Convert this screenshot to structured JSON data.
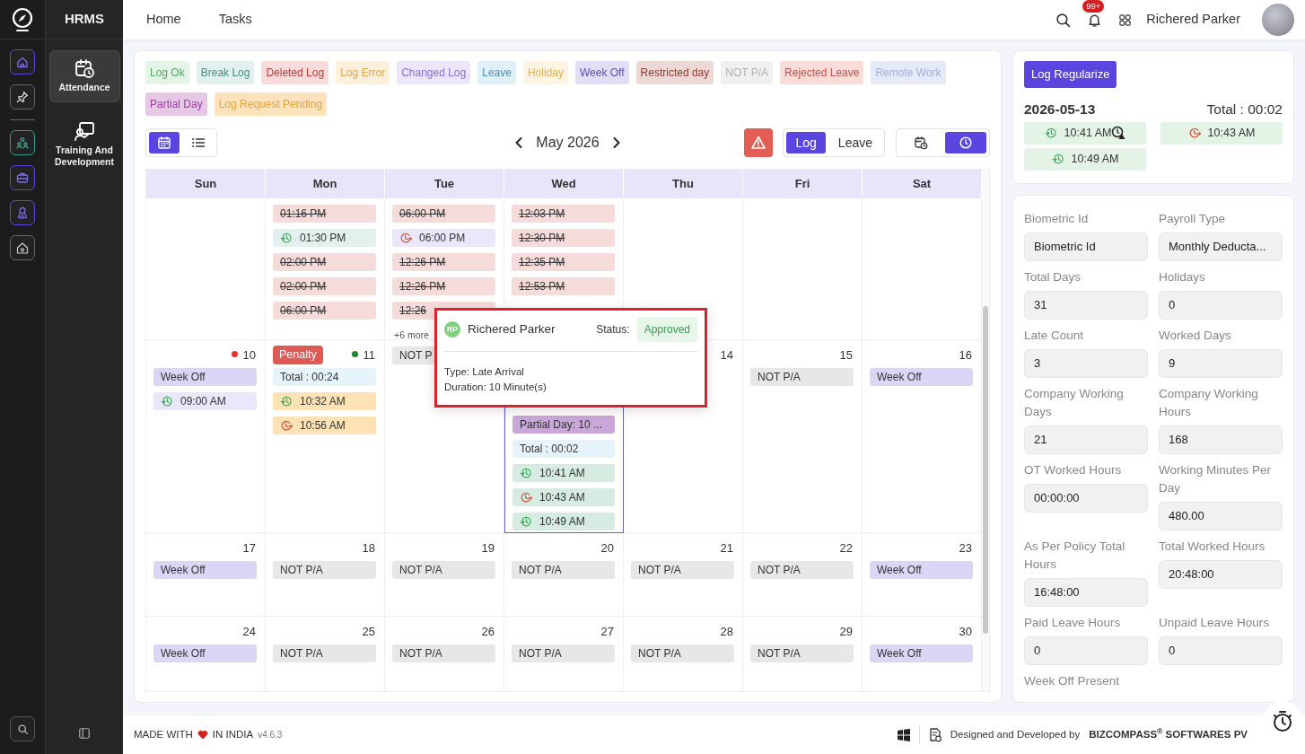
{
  "app": {
    "title": "HRMS"
  },
  "sidebar": {
    "items": [
      {
        "label": "Attendance",
        "kind": "attendance",
        "selected": true
      },
      {
        "label": "Training And Development",
        "kind": "training",
        "selected": false
      }
    ]
  },
  "header": {
    "nav": [
      "Home",
      "Tasks"
    ],
    "notifications": "99+",
    "user": "Richered Parker"
  },
  "legend": [
    {
      "label": "Log Ok",
      "kind": "log_ok"
    },
    {
      "label": "Break Log",
      "kind": "break_log"
    },
    {
      "label": "Deleted Log",
      "kind": "deleted"
    },
    {
      "label": "Log Error",
      "kind": "error"
    },
    {
      "label": "Changed Log",
      "kind": "changed"
    },
    {
      "label": "Leave",
      "kind": "leave"
    },
    {
      "label": "Holiday",
      "kind": "holiday"
    },
    {
      "label": "Week Off",
      "kind": "weekoff"
    },
    {
      "label": "Restricted day",
      "kind": "restricted"
    },
    {
      "label": "NOT P/A",
      "kind": "notpa"
    },
    {
      "label": "Rejected Leave",
      "kind": "rejected"
    },
    {
      "label": "Remote Work",
      "kind": "remote"
    },
    {
      "label": "Partial Day",
      "kind": "partial"
    },
    {
      "label": "Log Request Pending",
      "kind": "pending"
    }
  ],
  "toolbar": {
    "views": [
      {
        "kind": "calendar",
        "selected": true
      },
      {
        "kind": "list",
        "selected": false
      }
    ],
    "month": "May 2026",
    "modes": [
      {
        "label": "Log",
        "selected": true
      },
      {
        "label": "Leave",
        "selected": false
      }
    ],
    "tools": [
      {
        "kind": "calendar_clock",
        "selected": false
      },
      {
        "kind": "clock",
        "selected": true
      }
    ]
  },
  "calendar": {
    "weekdays": [
      "Sun",
      "Mon",
      "Tue",
      "Wed",
      "Thu",
      "Fri",
      "Sat"
    ],
    "weeks": [
      [
        {
          "selected": false
        },
        {
          "selected": false,
          "entries": [
            {
              "kind": "deleted",
              "text": "01:16 PM"
            },
            {
              "kind": "break_log",
              "clock_in": true,
              "text": "01:30 PM"
            },
            {
              "kind": "deleted",
              "text": "02:00 PM"
            },
            {
              "kind": "deleted",
              "text": "02:00 PM"
            },
            {
              "kind": "deleted",
              "text": "06:00 PM"
            }
          ]
        },
        {
          "selected": false,
          "more": "+6 more",
          "entries": [
            {
              "kind": "deleted",
              "text": "06:00 PM"
            },
            {
              "kind": "changed",
              "clock_out": true,
              "text": "06:00 PM"
            },
            {
              "kind": "deleted",
              "text": "12:26 PM"
            },
            {
              "kind": "deleted",
              "text": "12:26 PM"
            },
            {
              "kind": "deleted",
              "text": "12:26"
            }
          ]
        },
        {
          "selected": false,
          "entries": [
            {
              "kind": "deleted",
              "text": "12:03 PM"
            },
            {
              "kind": "deleted",
              "text": "12:30 PM"
            },
            {
              "kind": "deleted",
              "text": "12:35 PM"
            },
            {
              "kind": "deleted",
              "text": "12:53 PM"
            }
          ]
        },
        {
          "selected": false
        },
        {
          "selected": false
        },
        {
          "selected": false
        }
      ],
      [
        {
          "selected": false,
          "date": "10",
          "color": "#e0352b",
          "entries": [
            {
              "kind": "weekoff",
              "text": "Week Off"
            },
            {
              "kind": "changed",
              "clock_in": true,
              "text": "09:00 AM"
            }
          ]
        },
        {
          "selected": false,
          "date": "11",
          "color": "#1f8a2c",
          "badge": "Penalty",
          "entries": [
            {
              "kind": "leave",
              "text": "Total : 00:24"
            },
            {
              "kind": "pending",
              "clock_in": true,
              "text": "10:32 AM"
            },
            {
              "kind": "pending",
              "clock_out": true,
              "text": "10:56 AM"
            }
          ]
        },
        {
          "selected": false,
          "entries": [
            {
              "kind": "notpa",
              "text": "NOT P"
            }
          ]
        },
        {
          "selected": true,
          "entries": [
            {
              "kind": "partial",
              "text": "Partial Day: 10 ..."
            },
            {
              "kind": "leave",
              "text": "Total : 00:02"
            },
            {
              "kind": "log_ok",
              "clock_in": true,
              "text": "10:41 AM"
            },
            {
              "kind": "log_ok",
              "clock_out": true,
              "text": "10:43 AM"
            },
            {
              "kind": "log_ok",
              "clock_in": true,
              "text": "10:49 AM"
            }
          ]
        },
        {
          "selected": false,
          "date": "14"
        },
        {
          "selected": false,
          "date": "15",
          "entries": [
            {
              "kind": "notpa",
              "text": "NOT P/A"
            }
          ]
        },
        {
          "selected": false,
          "date": "16",
          "entries": [
            {
              "kind": "weekoff",
              "text": "Week Off"
            }
          ]
        }
      ],
      [
        {
          "selected": false,
          "date": "17",
          "entries": [
            {
              "kind": "weekoff",
              "text": "Week Off"
            }
          ]
        },
        {
          "selected": false,
          "date": "18",
          "entries": [
            {
              "kind": "notpa",
              "text": "NOT P/A"
            }
          ]
        },
        {
          "selected": false,
          "date": "19",
          "entries": [
            {
              "kind": "notpa",
              "text": "NOT P/A"
            }
          ]
        },
        {
          "selected": false,
          "date": "20",
          "entries": [
            {
              "kind": "notpa",
              "text": "NOT P/A"
            }
          ]
        },
        {
          "selected": false,
          "date": "21",
          "entries": [
            {
              "kind": "notpa",
              "text": "NOT P/A"
            }
          ]
        },
        {
          "selected": false,
          "date": "22",
          "entries": [
            {
              "kind": "notpa",
              "text": "NOT P/A"
            }
          ]
        },
        {
          "selected": false,
          "date": "23",
          "entries": [
            {
              "kind": "weekoff",
              "text": "Week Off"
            }
          ]
        }
      ],
      [
        {
          "selected": false,
          "date": "24",
          "entries": [
            {
              "kind": "weekoff",
              "text": "Week Off"
            }
          ]
        },
        {
          "selected": false,
          "date": "25",
          "entries": [
            {
              "kind": "notpa",
              "text": "NOT P/A"
            }
          ]
        },
        {
          "selected": false,
          "date": "26",
          "entries": [
            {
              "kind": "notpa",
              "text": "NOT P/A"
            }
          ]
        },
        {
          "selected": false,
          "date": "27",
          "entries": [
            {
              "kind": "notpa",
              "text": "NOT P/A"
            }
          ]
        },
        {
          "selected": false,
          "date": "28",
          "entries": [
            {
              "kind": "notpa",
              "text": "NOT P/A"
            }
          ]
        },
        {
          "selected": false,
          "date": "29",
          "entries": [
            {
              "kind": "notpa",
              "text": "NOT P/A"
            }
          ]
        },
        {
          "selected": false,
          "date": "30",
          "entries": [
            {
              "kind": "weekoff",
              "text": "Week Off"
            }
          ]
        }
      ]
    ]
  },
  "popover": {
    "initials": "RP",
    "name": "Richered Parker",
    "status_label": "Status:",
    "status": "Approved",
    "lines": [
      "Type: Late Arrival",
      "Duration: 10 Minute(s)"
    ]
  },
  "day_summary": {
    "button": "Log Regularize",
    "date": "2026-05-13",
    "total": "Total : 00:02",
    "entries": [
      {
        "kind": "in",
        "text": "10:41 AM",
        "warning": true
      },
      {
        "kind": "out",
        "text": "10:43 AM",
        "warning": false
      },
      {
        "kind": "in",
        "text": "10:49 AM",
        "warning": false
      }
    ]
  },
  "stats": [
    {
      "label": "Biometric Id",
      "value": "Biometric Id"
    },
    {
      "label": "Payroll Type",
      "value": "Monthly Deducta..."
    },
    {
      "label": "Total Days",
      "value": "31"
    },
    {
      "label": "Holidays",
      "value": "0"
    },
    {
      "label": "Late Count",
      "value": "3"
    },
    {
      "label": "Worked Days",
      "value": "9"
    },
    {
      "label": "Company Working Days",
      "value": "21"
    },
    {
      "label": "Company Working Hours",
      "value": "168"
    },
    {
      "label": "OT Worked Hours",
      "value": "00:00:00"
    },
    {
      "label": "Working Minutes Per Day",
      "value": "480.00"
    },
    {
      "label": "As Per Policy Total Hours",
      "value": "16:48:00"
    },
    {
      "label": "Total Worked Hours",
      "value": "20:48:00"
    },
    {
      "label": "Paid Leave Hours",
      "value": "0"
    },
    {
      "label": "Unpaid Leave Hours",
      "value": "0"
    },
    {
      "label": "Week Off Present"
    }
  ],
  "footer": {
    "made_with": "MADE WITH",
    "in_india": "IN INDIA",
    "version": "v4.6.3",
    "designed_by": "Designed and Developed by",
    "company": "BIZCOMPASS$^{®}$ SOFTWARES PV"
  }
}
